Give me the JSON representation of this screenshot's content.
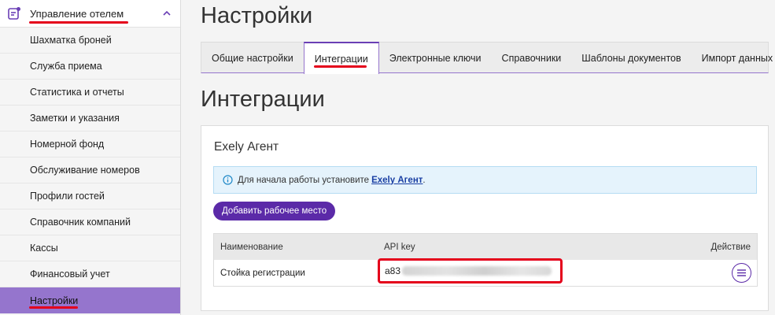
{
  "sidebar": {
    "section": {
      "label": "Управление отелем",
      "icon": "hotel-management-icon",
      "chevron": "chevron-up-icon"
    },
    "items": [
      {
        "label": "Шахматка броней"
      },
      {
        "label": "Служба приема"
      },
      {
        "label": "Статистика и отчеты"
      },
      {
        "label": "Заметки и указания"
      },
      {
        "label": "Номерной фонд"
      },
      {
        "label": "Обслуживание номеров"
      },
      {
        "label": "Профили гостей"
      },
      {
        "label": "Справочник компаний"
      },
      {
        "label": "Кассы"
      },
      {
        "label": "Финансовый учет"
      },
      {
        "label": "Настройки",
        "active": true
      }
    ]
  },
  "page": {
    "title": "Настройки"
  },
  "tabs": [
    {
      "label": "Общие настройки"
    },
    {
      "label": "Интеграции",
      "active": true
    },
    {
      "label": "Электронные ключи"
    },
    {
      "label": "Справочники"
    },
    {
      "label": "Шаблоны документов"
    },
    {
      "label": "Импорт данных"
    }
  ],
  "section": {
    "title": "Интеграции"
  },
  "card": {
    "title": "Exely Агент",
    "info": {
      "icon": "info-icon",
      "text_before": "Для начала работы установите",
      "link": "Exely Агент",
      "text_after": "."
    },
    "add_button": "Добавить рабочее место",
    "table": {
      "headers": {
        "name": "Наименование",
        "api_key": "API key",
        "action": "Действие"
      },
      "rows": [
        {
          "name": "Стойка регистрации",
          "api_key_prefix": "a83",
          "action_icon": "menu-icon"
        }
      ]
    }
  },
  "colors": {
    "accent": "#5b2aa8",
    "active_sidebar": "#9575cd",
    "highlight": "#e4001b",
    "info_bg": "#e5f3fc"
  }
}
